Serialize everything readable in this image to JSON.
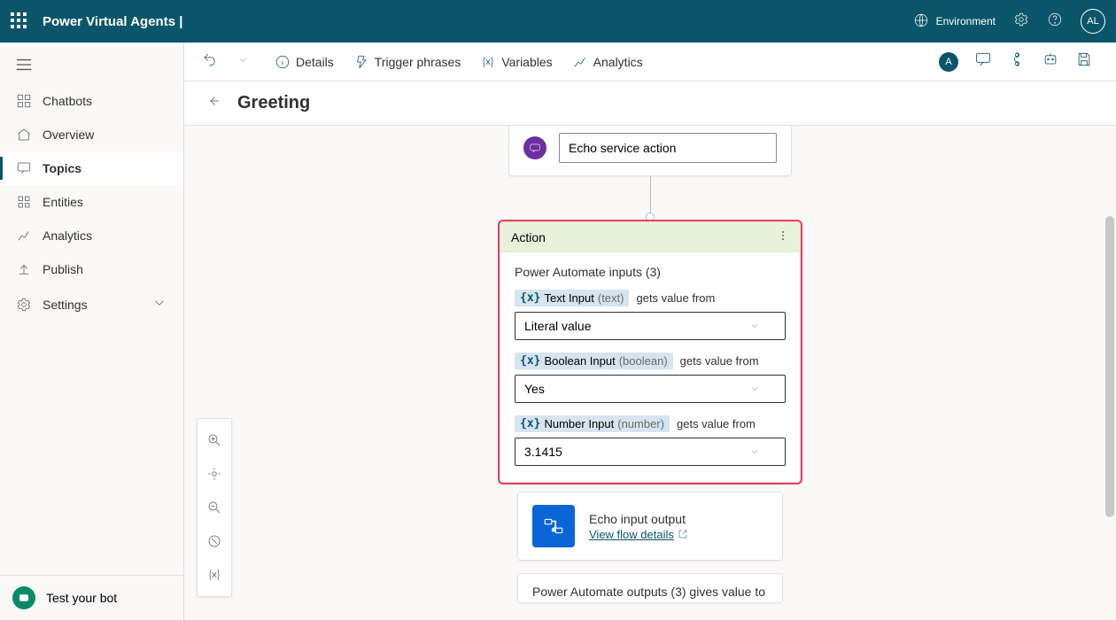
{
  "appbar": {
    "title": "Power Virtual Agents |",
    "environment_label": "Environment",
    "avatar_initials": "AL"
  },
  "sidebar": {
    "items": [
      {
        "label": "Chatbots"
      },
      {
        "label": "Overview"
      },
      {
        "label": "Topics"
      },
      {
        "label": "Entities"
      },
      {
        "label": "Analytics"
      },
      {
        "label": "Publish"
      },
      {
        "label": "Settings"
      }
    ],
    "test_bot_label": "Test your bot"
  },
  "toolbar": {
    "details": "Details",
    "trigger": "Trigger phrases",
    "variables": "Variables",
    "analytics": "Analytics",
    "avatar_pill": "A"
  },
  "page": {
    "title": "Greeting"
  },
  "trigger_node": {
    "value": "Echo service action"
  },
  "action_node": {
    "header": "Action",
    "subtitle": "Power Automate inputs (3)",
    "inputs": [
      {
        "name": "Text Input",
        "type": "(text)",
        "gets": "gets value from",
        "value": "Literal value"
      },
      {
        "name": "Boolean Input",
        "type": "(boolean)",
        "gets": "gets value from",
        "value": "Yes"
      },
      {
        "name": "Number Input",
        "type": "(number)",
        "gets": "gets value from",
        "value": "3.1415"
      }
    ]
  },
  "flow_node": {
    "title": "Echo input output",
    "link_label": "View flow details"
  },
  "outputs_node": {
    "text": "Power Automate outputs (3) gives value to"
  }
}
